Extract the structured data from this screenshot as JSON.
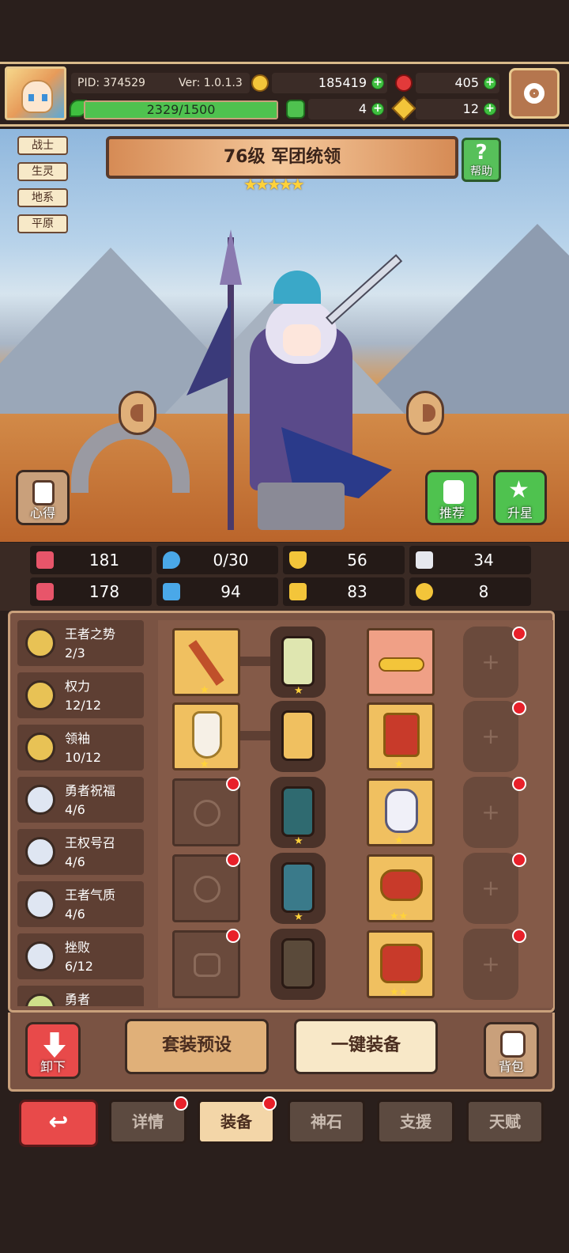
{
  "header": {
    "pid": "PID: 374529",
    "version": "Ver: 1.0.1.3",
    "gold": "185419",
    "gems": "405",
    "exp": "2329/1500",
    "clover": "4",
    "keys": "12"
  },
  "tags": [
    "战士",
    "生灵",
    "地系",
    "平原"
  ],
  "hero": {
    "title": "76级 军团统领",
    "stars": "★★★★★",
    "help": "帮助"
  },
  "buttons": {
    "insight": "心得",
    "recommend": "推荐",
    "upgrade": "升星"
  },
  "stats": {
    "hp": "181",
    "mana": "0/30",
    "armor": "56",
    "speed": "34",
    "attack": "178",
    "intel": "94",
    "crit": "83",
    "luck": "8"
  },
  "sets": [
    {
      "name": "王者之势",
      "count": "2/3",
      "color": "#e8c255"
    },
    {
      "name": "权力",
      "count": "12/12",
      "color": "#e8c255"
    },
    {
      "name": "领袖",
      "count": "10/12",
      "color": "#e8c255"
    },
    {
      "name": "勇者祝福",
      "count": "4/6",
      "color": "#dfe6f2"
    },
    {
      "name": "王权号召",
      "count": "4/6",
      "color": "#dfe6f2"
    },
    {
      "name": "王者气质",
      "count": "4/6",
      "color": "#dfe6f2"
    },
    {
      "name": "挫败",
      "count": "6/12",
      "color": "#dfe6f2"
    },
    {
      "name": "勇者",
      "count": "",
      "color": "#cfe08a"
    }
  ],
  "actions": {
    "unequip": "卸下",
    "preset": "套装预设",
    "equip_all": "一键装备",
    "bag": "背包"
  },
  "tabs": [
    "详情",
    "装备",
    "神石",
    "支援",
    "天赋"
  ],
  "colors": {
    "accent": "#f3d6a8",
    "alert": "#e8202a",
    "plus": "#3fbf3f"
  }
}
